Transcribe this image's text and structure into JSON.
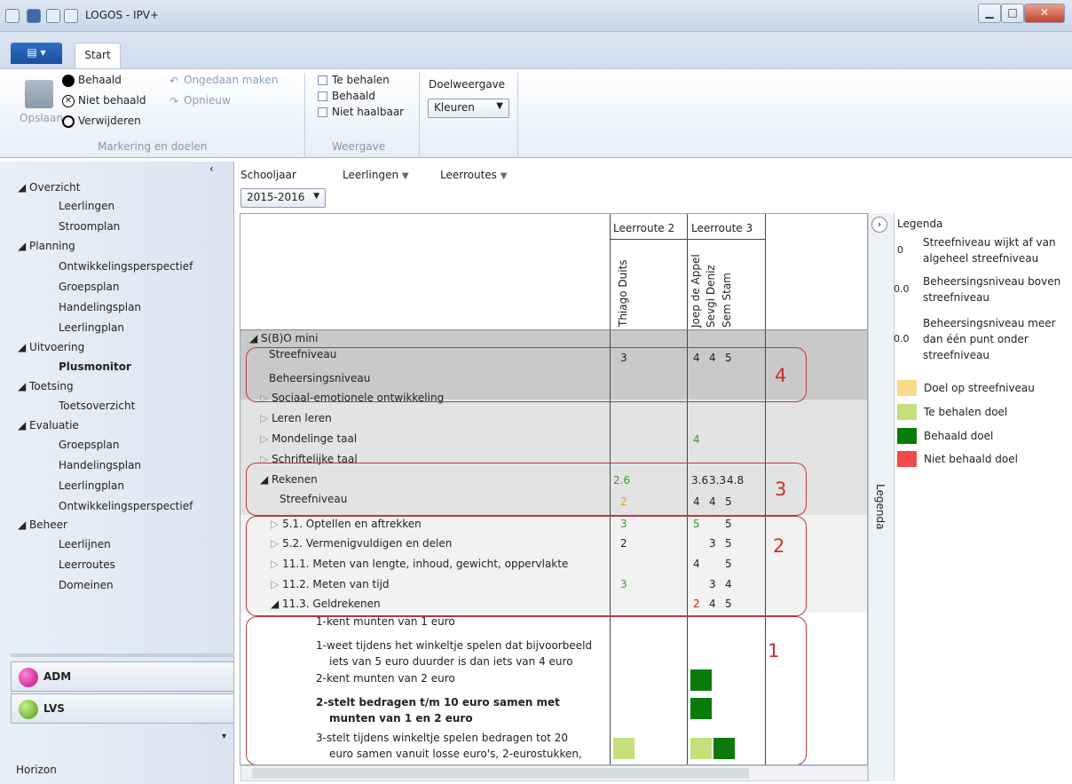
{
  "window": {
    "title": "LOGOS - IPV+"
  },
  "ribbon": {
    "tab_start": "Start",
    "save": "Opslaan",
    "behaald": "Behaald",
    "niet_behaald": "Niet behaald",
    "verwijderen": "Verwijderen",
    "ongedaan": "Ongedaan maken",
    "opnieuw": "Opnieuw",
    "group_markering": "Markering en doelen",
    "te_behalen": "Te behalen",
    "cb_behaald": "Behaald",
    "niet_haalbaar": "Niet haalbaar",
    "group_weergave": "Weergave",
    "doelweergave": "Doelweergave",
    "doelweergave_value": "Kleuren"
  },
  "nav": {
    "overzicht": "Overzicht",
    "leerlingen": "Leerlingen",
    "stroomplan": "Stroomplan",
    "planning": "Planning",
    "ontwikkelingsperspectief": "Ontwikkelingsperspectief",
    "groepsplan": "Groepsplan",
    "handelingsplan": "Handelingsplan",
    "leerlingplan": "Leerlingplan",
    "uitvoering": "Uitvoering",
    "plusmonitor": "Plusmonitor",
    "toetsing": "Toetsing",
    "toetsoverzicht": "Toetsoverzicht",
    "evaluatie": "Evaluatie",
    "ev_groepsplan": "Groepsplan",
    "ev_handelingsplan": "Handelingsplan",
    "ev_leerlingplan": "Leerlingplan",
    "ev_ontwikkelingsperspectief": "Ontwikkelingsperspectief",
    "beheer": "Beheer",
    "leerlijnen": "Leerlijnen",
    "leerroutes": "Leerroutes",
    "domeinen": "Domeinen",
    "adm": "ADM",
    "lvs": "LVS",
    "horizon": "Horizon"
  },
  "filters": {
    "schooljaar": "Schooljaar",
    "schooljaar_value": "2015-2016",
    "leerlingen": "Leerlingen",
    "leerroutes": "Leerroutes"
  },
  "grid": {
    "route2": "Leerroute 2",
    "route3": "Leerroute 3",
    "students": [
      "Thiago Duits",
      "Joep de Appel",
      "Sevgi Deniz",
      "Sem Stam"
    ],
    "rows": {
      "sbo": "S(B)O mini",
      "streef": "Streefniveau",
      "beheers": "Beheersingsniveau",
      "sociaal": "Sociaal-emotionele ontwikkeling",
      "leren": "Leren leren",
      "mondeling": "Mondelinge taal",
      "schriftelijk": "Schriftelijke taal",
      "rekenen": "Rekenen",
      "rek_streef": "Streefniveau",
      "r51": "5.1. Optellen en aftrekken",
      "r52": "5.2. Vermenigvuldigen en delen",
      "r111": "11.1. Meten van lengte, inhoud, gewicht, oppervlakte",
      "r112": "11.2. Meten van tijd",
      "r113": "11.3. Geldrekenen",
      "g1": "1-kent munten van 1 euro",
      "g2a": "1-weet tijdens het winkeltje spelen dat bijvoorbeeld",
      "g2b": "iets van 5 euro duurder is dan iets van 4 euro",
      "g3": "2-kent munten van 2 euro",
      "g4a": "2-stelt bedragen t/m 10 euro samen met",
      "g4b": "munten van 1 en 2 euro",
      "g5a": "3-stelt tijdens winkeltje spelen bedragen tot 20",
      "g5b": "euro samen vanuit losse euro's, 2-eurostukken,"
    },
    "vals": {
      "streef_t": "3",
      "streef_j": "4",
      "streef_s": "4",
      "streef_m": "5",
      "mond_j": "4",
      "rek_t": "2.6",
      "rek_j": "3.6",
      "rek_s": "3.3",
      "rek_m": "4.8",
      "rs_t": "2",
      "rs_j": "4",
      "rs_s": "4",
      "rs_m": "5",
      "r51_t": "3",
      "r51_j": "5",
      "r51_m": "5",
      "r52_t": "2",
      "r52_s": "3",
      "r52_m": "5",
      "r111_j": "4",
      "r111_m": "5",
      "r112_t": "3",
      "r112_s": "3",
      "r112_m": "4",
      "r113_j": "2",
      "r113_s": "4",
      "r113_m": "5"
    },
    "box_labels": [
      "4",
      "3",
      "2",
      "1"
    ]
  },
  "legend": {
    "tab": "Legenda",
    "title": "Legenda",
    "l1_num": "0",
    "l1": "Streefniveau wijkt af van algeheel streefniveau",
    "l2_num": "0.0",
    "l2": "Beheersingsniveau boven streefniveau",
    "l3_num": "0.0",
    "l3": "Beheersingsniveau meer dan één punt onder streefniveau",
    "s1": "Doel op streefniveau",
    "s2": "Te behalen doel",
    "s3": "Behaald doel",
    "s4": "Niet behaald doel",
    "colors": {
      "doel_op_streef": "#fbd98a",
      "te_behalen": "#c4e07a",
      "behaald": "#0a7a0a",
      "niet_behaald": "#f24a4a"
    }
  }
}
